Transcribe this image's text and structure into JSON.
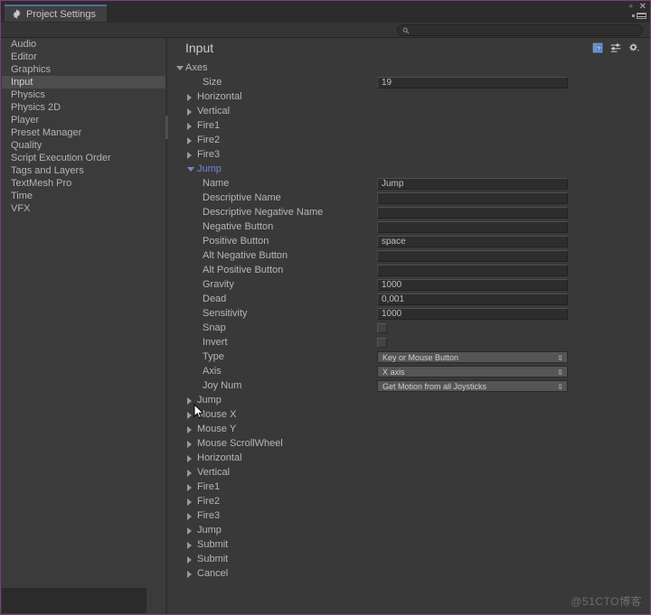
{
  "window": {
    "tab_label": "Project Settings",
    "tab_icon": "gear-icon",
    "maximize_label": "▫",
    "close_label": "✕",
    "accent_color": "#4a6fa5",
    "border_color": "#6b4a6b"
  },
  "search": {
    "value": "",
    "placeholder": "",
    "icon": "search-icon"
  },
  "sidebar": {
    "items": [
      {
        "label": "Audio",
        "selected": false
      },
      {
        "label": "Editor",
        "selected": false
      },
      {
        "label": "Graphics",
        "selected": false
      },
      {
        "label": "Input",
        "selected": true
      },
      {
        "label": "Physics",
        "selected": false
      },
      {
        "label": "Physics 2D",
        "selected": false
      },
      {
        "label": "Player",
        "selected": false
      },
      {
        "label": "Preset Manager",
        "selected": false
      },
      {
        "label": "Quality",
        "selected": false
      },
      {
        "label": "Script Execution Order",
        "selected": false
      },
      {
        "label": "Tags and Layers",
        "selected": false
      },
      {
        "label": "TextMesh Pro",
        "selected": false
      },
      {
        "label": "Time",
        "selected": false
      },
      {
        "label": "VFX",
        "selected": false
      }
    ]
  },
  "main": {
    "title": "Input",
    "tools": [
      {
        "name": "help-icon",
        "glyph": "?"
      },
      {
        "name": "preset-icon",
        "glyph": "⇥"
      },
      {
        "name": "settings-gear-icon",
        "glyph": "⚙"
      }
    ],
    "root": {
      "label": "Axes",
      "expanded": true
    },
    "size": {
      "label": "Size",
      "value": "19"
    },
    "axes_before": [
      {
        "label": "Horizontal"
      },
      {
        "label": "Vertical"
      },
      {
        "label": "Fire1"
      },
      {
        "label": "Fire2"
      },
      {
        "label": "Fire3"
      }
    ],
    "expanded_axis": {
      "label": "Jump",
      "expanded": true,
      "properties": [
        {
          "label": "Name",
          "kind": "text",
          "value": "Jump"
        },
        {
          "label": "Descriptive Name",
          "kind": "text",
          "value": ""
        },
        {
          "label": "Descriptive Negative Name",
          "kind": "text",
          "value": ""
        },
        {
          "label": "Negative Button",
          "kind": "text",
          "value": ""
        },
        {
          "label": "Positive Button",
          "kind": "text",
          "value": "space"
        },
        {
          "label": "Alt Negative Button",
          "kind": "text",
          "value": ""
        },
        {
          "label": "Alt Positive Button",
          "kind": "text",
          "value": ""
        },
        {
          "label": "Gravity",
          "kind": "text",
          "value": "1000"
        },
        {
          "label": "Dead",
          "kind": "text",
          "value": "0,001"
        },
        {
          "label": "Sensitivity",
          "kind": "text",
          "value": "1000"
        },
        {
          "label": "Snap",
          "kind": "checkbox",
          "value": ""
        },
        {
          "label": "Invert",
          "kind": "checkbox",
          "value": ""
        },
        {
          "label": "Type",
          "kind": "dropdown",
          "value": "Key or Mouse Button"
        },
        {
          "label": "Axis",
          "kind": "dropdown",
          "value": "X axis"
        },
        {
          "label": "Joy Num",
          "kind": "dropdown",
          "value": "Get Motion from all Joysticks"
        }
      ]
    },
    "axes_after": [
      {
        "label": "Jump"
      },
      {
        "label": "Mouse X"
      },
      {
        "label": "Mouse Y"
      },
      {
        "label": "Mouse ScrollWheel"
      },
      {
        "label": "Horizontal"
      },
      {
        "label": "Vertical"
      },
      {
        "label": "Fire1"
      },
      {
        "label": "Fire2"
      },
      {
        "label": "Fire3"
      },
      {
        "label": "Jump"
      },
      {
        "label": "Submit"
      },
      {
        "label": "Submit"
      },
      {
        "label": "Cancel"
      }
    ]
  },
  "watermark": {
    "text": "@51CTO博客"
  }
}
